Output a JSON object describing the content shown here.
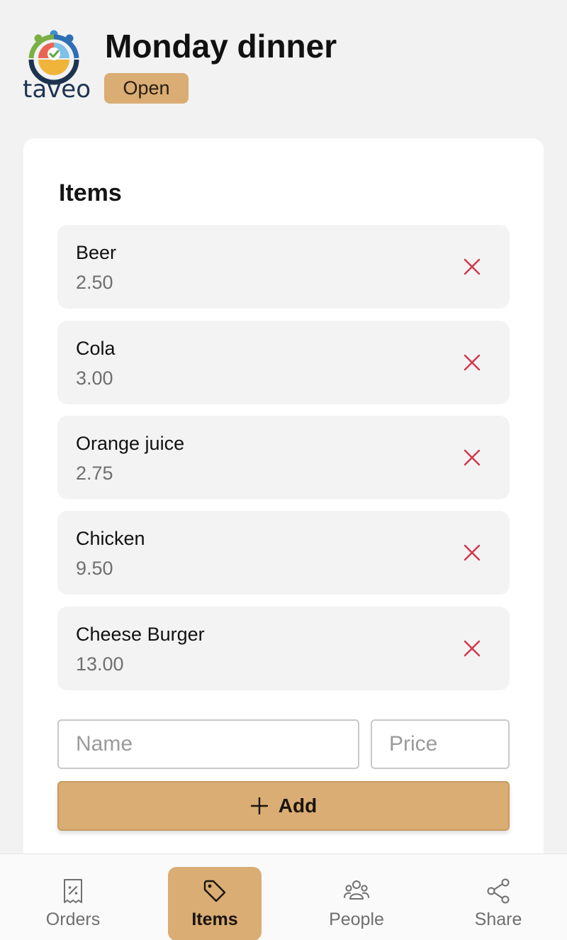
{
  "app": {
    "logo_text": "taveo",
    "title": "Monday dinner",
    "status_badge": "Open"
  },
  "colors": {
    "accent": "#d9ad74",
    "remove_icon": "#d2344a",
    "background": "#f2f2f2"
  },
  "items_section": {
    "title": "Items",
    "items": [
      {
        "name": "Beer",
        "price": "2.50"
      },
      {
        "name": "Cola",
        "price": "3.00"
      },
      {
        "name": "Orange juice",
        "price": "2.75"
      },
      {
        "name": "Chicken",
        "price": "9.50"
      },
      {
        "name": "Cheese Burger",
        "price": "13.00"
      }
    ],
    "name_input": {
      "placeholder": "Name",
      "value": ""
    },
    "price_input": {
      "placeholder": "Price",
      "value": ""
    },
    "add_button": {
      "label": "Add",
      "icon": "plus-icon"
    }
  },
  "bottom_nav": {
    "active": "Items",
    "items": [
      {
        "label": "Orders",
        "icon": "receipt-percent-icon"
      },
      {
        "label": "Items",
        "icon": "tag-icon"
      },
      {
        "label": "People",
        "icon": "people-icon"
      },
      {
        "label": "Share",
        "icon": "share-icon"
      }
    ]
  }
}
